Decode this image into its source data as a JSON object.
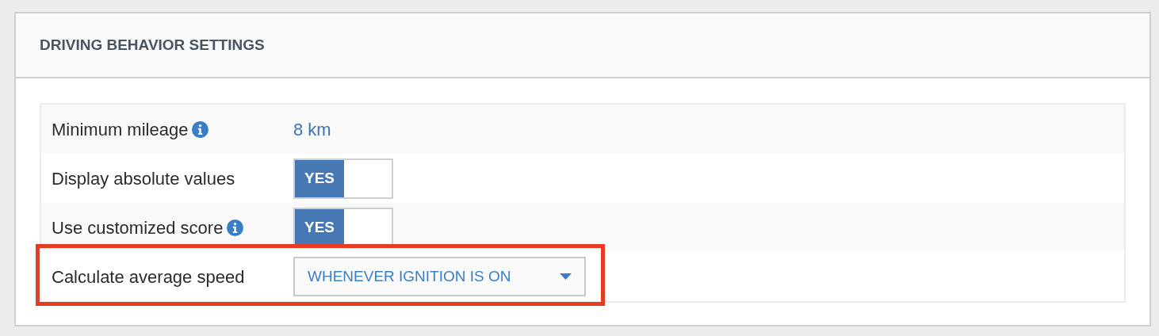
{
  "panel": {
    "title": "DRIVING BEHAVIOR SETTINGS"
  },
  "settings": [
    {
      "kind": "value",
      "label": "Minimum mileage",
      "info": true,
      "value": "8 km",
      "highlighted": false
    },
    {
      "kind": "toggle",
      "label": "Display absolute values",
      "info": false,
      "on": true,
      "on_label": "YES",
      "highlighted": false
    },
    {
      "kind": "toggle",
      "label": "Use customized score",
      "info": true,
      "on": true,
      "on_label": "YES",
      "highlighted": false
    },
    {
      "kind": "select",
      "label": "Calculate average speed",
      "info": false,
      "value": "WHENEVER IGNITION IS ON",
      "highlighted": true
    }
  ]
}
